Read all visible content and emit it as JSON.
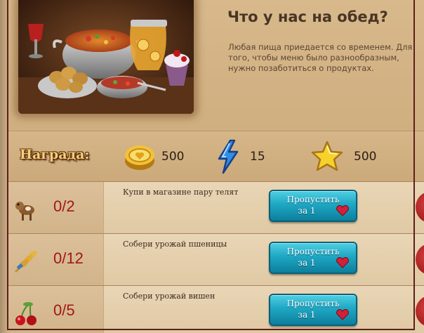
{
  "quest": {
    "title": "Что у нас на обед?",
    "description": "Любая пища приедается со временем. Для того, чтобы меню было разнообразным, нужно позаботиться о продуктах."
  },
  "reward": {
    "label": "Награда:",
    "items": [
      {
        "icon": "gold-coin-icon",
        "value": "500"
      },
      {
        "icon": "energy-bolt-icon",
        "value": "15"
      },
      {
        "icon": "star-icon",
        "value": "500"
      }
    ]
  },
  "tasks": [
    {
      "icon": "calf-icon",
      "progress": "0/2",
      "text": "Купи в магазине пару телят",
      "button_line1": "Пропустить",
      "button_line2": "за 1"
    },
    {
      "icon": "wheat-icon",
      "progress": "0/12",
      "text": "Собери урожай пшеницы",
      "button_line1": "Пропустить",
      "button_line2": "за 1"
    },
    {
      "icon": "cherry-icon",
      "progress": "0/5",
      "text": "Собери урожай вишен",
      "button_line1": "Пропустить",
      "button_line2": "за 1"
    }
  ],
  "colors": {
    "button": "#1ea7c4",
    "progress": "#a01818",
    "frame": "#5c1f1a"
  }
}
